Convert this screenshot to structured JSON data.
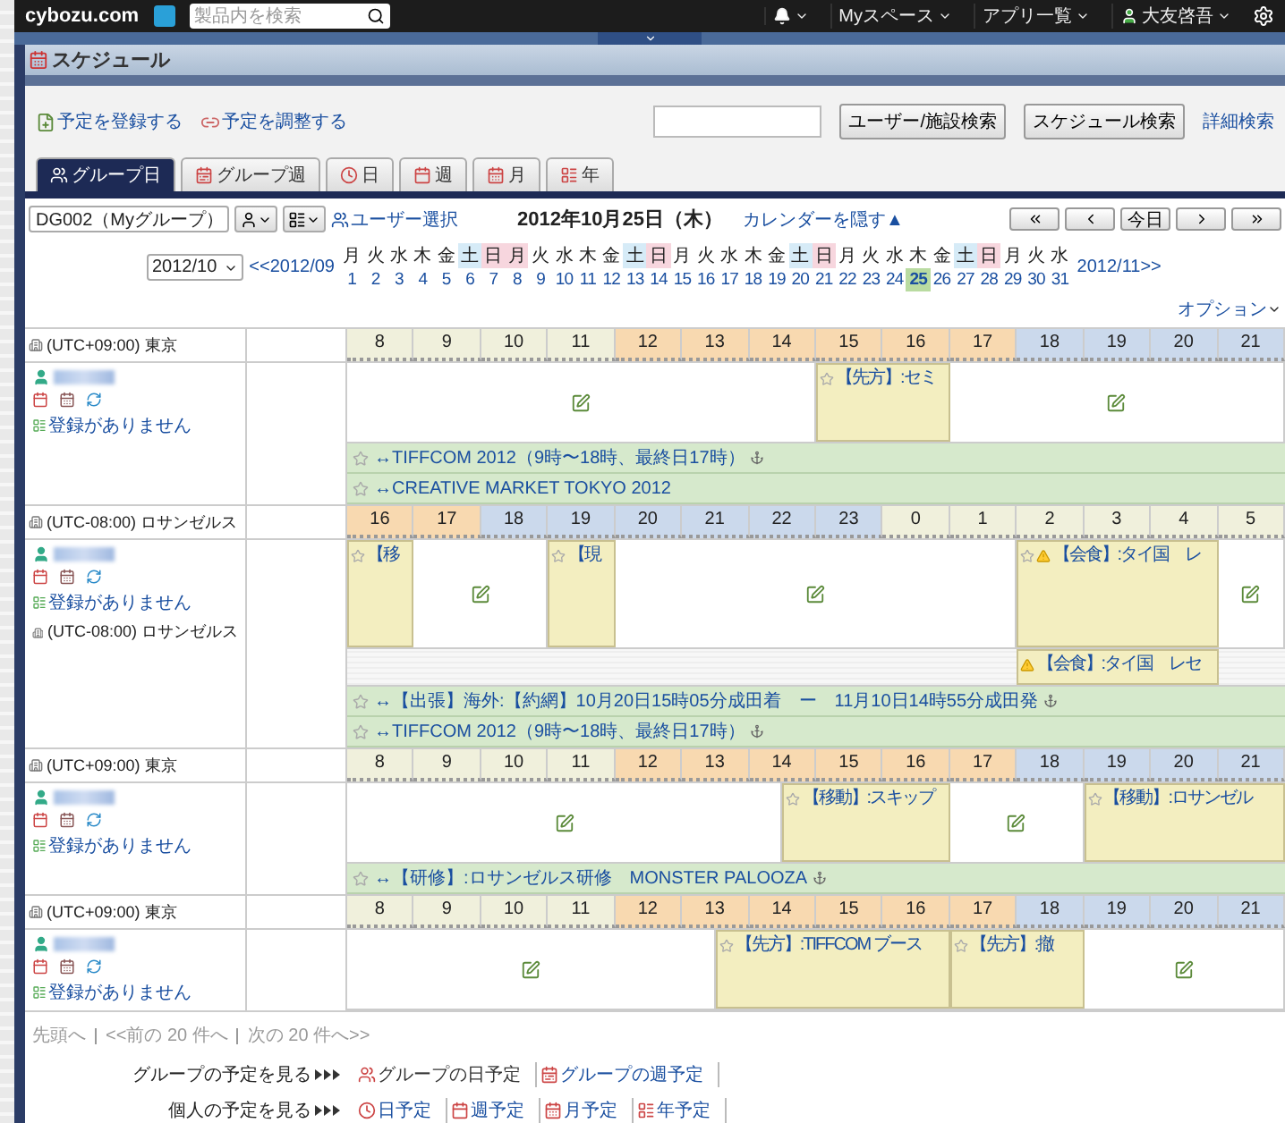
{
  "topbar": {
    "logo": "cybozu.com",
    "search_placeholder": "製品内を検索",
    "menus": [
      "Myスペース",
      "アプリ一覧"
    ],
    "user": "大友啓吾"
  },
  "app_title": "スケジュール",
  "actions": [
    "予定を登録する",
    "予定を調整する"
  ],
  "search_buttons": [
    "ユーザー/施設検索",
    "スケジュール検索"
  ],
  "advanced_search": "詳細検索",
  "tabs": [
    {
      "label": "グループ日",
      "kind": "group-day",
      "selected": true
    },
    {
      "label": "グループ週",
      "kind": "group-week",
      "selected": false
    },
    {
      "label": "日",
      "kind": "day",
      "selected": false
    },
    {
      "label": "週",
      "kind": "week",
      "selected": false
    },
    {
      "label": "月",
      "kind": "month",
      "selected": false
    },
    {
      "label": "年",
      "kind": "year",
      "selected": false
    }
  ],
  "group_select": "DG002（Myグループ）",
  "user_select": "ユーザー選択",
  "date_title": "2012年10月25日（木）",
  "hide_calendar": "カレンダーを隠す▲",
  "today_button": "今日",
  "calendar": {
    "month": "2012/10",
    "prev": "<<2012/09",
    "next": "2012/11>>",
    "days": [
      {
        "dow": "月",
        "day": "1",
        "kind": "weekday",
        "selected": false
      },
      {
        "dow": "火",
        "day": "2",
        "kind": "weekday",
        "selected": false
      },
      {
        "dow": "水",
        "day": "3",
        "kind": "weekday",
        "selected": false
      },
      {
        "dow": "木",
        "day": "4",
        "kind": "weekday",
        "selected": false
      },
      {
        "dow": "金",
        "day": "5",
        "kind": "weekday",
        "selected": false
      },
      {
        "dow": "土",
        "day": "6",
        "kind": "saturday",
        "selected": false
      },
      {
        "dow": "日",
        "day": "7",
        "kind": "sunday",
        "selected": false
      },
      {
        "dow": "月",
        "day": "8",
        "kind": "holiday",
        "selected": false
      },
      {
        "dow": "火",
        "day": "9",
        "kind": "weekday",
        "selected": false
      },
      {
        "dow": "水",
        "day": "10",
        "kind": "weekday",
        "selected": false
      },
      {
        "dow": "木",
        "day": "11",
        "kind": "weekday",
        "selected": false
      },
      {
        "dow": "金",
        "day": "12",
        "kind": "weekday",
        "selected": false
      },
      {
        "dow": "土",
        "day": "13",
        "kind": "saturday",
        "selected": false
      },
      {
        "dow": "日",
        "day": "14",
        "kind": "sunday",
        "selected": false
      },
      {
        "dow": "月",
        "day": "15",
        "kind": "weekday",
        "selected": false
      },
      {
        "dow": "火",
        "day": "16",
        "kind": "weekday",
        "selected": false
      },
      {
        "dow": "水",
        "day": "17",
        "kind": "weekday",
        "selected": false
      },
      {
        "dow": "木",
        "day": "18",
        "kind": "weekday",
        "selected": false
      },
      {
        "dow": "金",
        "day": "19",
        "kind": "weekday",
        "selected": false
      },
      {
        "dow": "土",
        "day": "20",
        "kind": "saturday",
        "selected": false
      },
      {
        "dow": "日",
        "day": "21",
        "kind": "sunday",
        "selected": false
      },
      {
        "dow": "月",
        "day": "22",
        "kind": "weekday",
        "selected": false
      },
      {
        "dow": "火",
        "day": "23",
        "kind": "weekday",
        "selected": false
      },
      {
        "dow": "水",
        "day": "24",
        "kind": "weekday",
        "selected": false
      },
      {
        "dow": "木",
        "day": "25",
        "kind": "weekday",
        "selected": true
      },
      {
        "dow": "金",
        "day": "26",
        "kind": "weekday",
        "selected": false
      },
      {
        "dow": "土",
        "day": "27",
        "kind": "saturday",
        "selected": false
      },
      {
        "dow": "日",
        "day": "28",
        "kind": "sunday",
        "selected": false
      },
      {
        "dow": "月",
        "day": "29",
        "kind": "weekday",
        "selected": false
      },
      {
        "dow": "火",
        "day": "30",
        "kind": "weekday",
        "selected": false
      },
      {
        "dow": "水",
        "day": "31",
        "kind": "weekday",
        "selected": false
      }
    ]
  },
  "options": "オプション",
  "rows": [
    {
      "kind": "hours",
      "timezone": "(UTC+09:00) 東京",
      "hours": [
        {
          "label": "8",
          "color": "#f0f0dc"
        },
        {
          "label": "9",
          "color": "#f0f0dc"
        },
        {
          "label": "10",
          "color": "#f0f0dc"
        },
        {
          "label": "11",
          "color": "#f0f0dc"
        },
        {
          "label": "12",
          "color": "#f8d9b0"
        },
        {
          "label": "13",
          "color": "#f8d9b0"
        },
        {
          "label": "14",
          "color": "#f8d9b0"
        },
        {
          "label": "15",
          "color": "#f8d9b0"
        },
        {
          "label": "16",
          "color": "#f8d9b0"
        },
        {
          "label": "17",
          "color": "#f8d9b0"
        },
        {
          "label": "18",
          "color": "#cbd9ec"
        },
        {
          "label": "19",
          "color": "#cbd9ec"
        },
        {
          "label": "20",
          "color": "#cbd9ec"
        },
        {
          "label": "21",
          "color": "#cbd9ec"
        }
      ]
    },
    {
      "kind": "user",
      "todo": "登録がありません",
      "lane": [
        {
          "kind": "free"
        },
        {
          "kind": "event",
          "text": "【先方】:セミ",
          "star": true,
          "warning": false
        },
        {
          "kind": "free"
        }
      ],
      "banners": [
        {
          "text": "↔TIFFCOM 2012（9時〜18時、最終日17時）",
          "anchor": true
        },
        {
          "text": "↔CREATIVE MARKET TOKYO 2012",
          "anchor": false
        }
      ]
    },
    {
      "kind": "hours",
      "timezone": "(UTC-08:00) ロサンゼルス",
      "hours": [
        {
          "label": "16",
          "color": "#f8d9b0"
        },
        {
          "label": "17",
          "color": "#f8d9b0"
        },
        {
          "label": "18",
          "color": "#cbd9ec"
        },
        {
          "label": "19",
          "color": "#cbd9ec"
        },
        {
          "label": "20",
          "color": "#cbd9ec"
        },
        {
          "label": "21",
          "color": "#cbd9ec"
        },
        {
          "label": "22",
          "color": "#cbd9ec"
        },
        {
          "label": "23",
          "color": "#cbd9ec"
        },
        {
          "label": "0",
          "color": "#f0f0dc"
        },
        {
          "label": "1",
          "color": "#f0f0dc"
        },
        {
          "label": "2",
          "color": "#f0f0dc"
        },
        {
          "label": "3",
          "color": "#f0f0dc"
        },
        {
          "label": "4",
          "color": "#f0f0dc"
        },
        {
          "label": "5",
          "color": "#f0f0dc"
        }
      ]
    },
    {
      "kind": "user",
      "todo": "登録がありません",
      "timezone": "(UTC-08:00) ロサンゼルス",
      "lane": [
        {
          "kind": "event",
          "text": "【移",
          "star": true,
          "warning": false
        },
        {
          "kind": "free"
        },
        {
          "kind": "event",
          "text": "【現",
          "star": true,
          "warning": false
        },
        {
          "kind": "free"
        },
        {
          "kind": "event",
          "text": "【会食】:タイ国　レ",
          "star": true,
          "warning": true
        },
        {
          "kind": "free"
        }
      ],
      "lane2": [
        {
          "kind": "blank"
        },
        {
          "kind": "event",
          "text": "【会食】:タイ国　レセ",
          "star": false,
          "warning": true
        },
        {
          "kind": "blank"
        }
      ],
      "banners": [
        {
          "text": "↔【出張】海外:【約網】10月20日15時05分成田着　ー　11月10日14時55分成田発",
          "anchor": true
        },
        {
          "text": "↔TIFFCOM 2012（9時〜18時、最終日17時）",
          "anchor": true
        }
      ]
    },
    {
      "kind": "hours",
      "timezone": "(UTC+09:00) 東京",
      "hours": [
        {
          "label": "8",
          "color": "#f0f0dc"
        },
        {
          "label": "9",
          "color": "#f0f0dc"
        },
        {
          "label": "10",
          "color": "#f0f0dc"
        },
        {
          "label": "11",
          "color": "#f0f0dc"
        },
        {
          "label": "12",
          "color": "#f8d9b0"
        },
        {
          "label": "13",
          "color": "#f8d9b0"
        },
        {
          "label": "14",
          "color": "#f8d9b0"
        },
        {
          "label": "15",
          "color": "#f8d9b0"
        },
        {
          "label": "16",
          "color": "#f8d9b0"
        },
        {
          "label": "17",
          "color": "#f8d9b0"
        },
        {
          "label": "18",
          "color": "#cbd9ec"
        },
        {
          "label": "19",
          "color": "#cbd9ec"
        },
        {
          "label": "20",
          "color": "#cbd9ec"
        },
        {
          "label": "21",
          "color": "#cbd9ec"
        }
      ]
    },
    {
      "kind": "user",
      "todo": "登録がありません",
      "lane": [
        {
          "kind": "free"
        },
        {
          "kind": "event",
          "text": "【移動】:スキップ",
          "star": true,
          "warning": false
        },
        {
          "kind": "free"
        },
        {
          "kind": "event",
          "text": "【移動】:ロサンゼル",
          "star": true,
          "warning": false
        }
      ],
      "banners": [
        {
          "text": "↔【研修】:ロサンゼルス研修　MONSTER PALOOZA",
          "anchor": true
        }
      ]
    },
    {
      "kind": "hours",
      "timezone": "(UTC+09:00) 東京",
      "hours": [
        {
          "label": "8",
          "color": "#f0f0dc"
        },
        {
          "label": "9",
          "color": "#f0f0dc"
        },
        {
          "label": "10",
          "color": "#f0f0dc"
        },
        {
          "label": "11",
          "color": "#f0f0dc"
        },
        {
          "label": "12",
          "color": "#f8d9b0"
        },
        {
          "label": "13",
          "color": "#f8d9b0"
        },
        {
          "label": "14",
          "color": "#f8d9b0"
        },
        {
          "label": "15",
          "color": "#f8d9b0"
        },
        {
          "label": "16",
          "color": "#f8d9b0"
        },
        {
          "label": "17",
          "color": "#f8d9b0"
        },
        {
          "label": "18",
          "color": "#cbd9ec"
        },
        {
          "label": "19",
          "color": "#cbd9ec"
        },
        {
          "label": "20",
          "color": "#cbd9ec"
        },
        {
          "label": "21",
          "color": "#cbd9ec"
        }
      ]
    },
    {
      "kind": "user",
      "todo": "登録がありません",
      "lane": [
        {
          "kind": "free"
        },
        {
          "kind": "event",
          "text": "【先方】:TIFFCOM ブース",
          "star": true,
          "warning": false
        },
        {
          "kind": "event",
          "text": "【先方】:撤",
          "star": true,
          "warning": false
        },
        {
          "kind": "free"
        }
      ]
    }
  ],
  "pagination": [
    {
      "label": "先頭へ",
      "disabled": true
    },
    {
      "label": "<<前の 20 件へ",
      "disabled": true
    },
    {
      "label": "次の 20 件へ>>",
      "disabled": true
    }
  ],
  "view_links": [
    {
      "label": "グループの予定を見る",
      "links": [
        {
          "label": "グループの日予定",
          "kind": "group-day",
          "selected": true
        },
        {
          "label": "グループの週予定",
          "kind": "group-week",
          "selected": false
        }
      ]
    },
    {
      "label": "個人の予定を見る",
      "links": [
        {
          "label": "日予定",
          "kind": "day",
          "selected": false
        },
        {
          "label": "週予定",
          "kind": "week",
          "selected": false
        },
        {
          "label": "月予定",
          "kind": "month",
          "selected": false
        },
        {
          "label": "年予定",
          "kind": "year",
          "selected": false
        }
      ]
    }
  ]
}
